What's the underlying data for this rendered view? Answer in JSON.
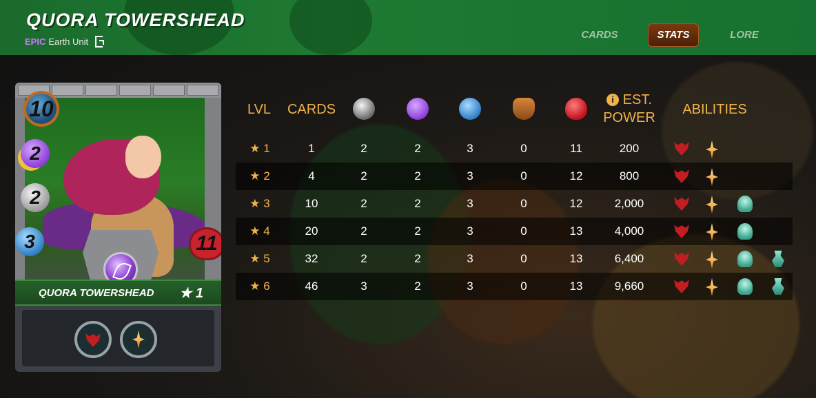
{
  "header": {
    "title": "QUORA TOWERSHEAD",
    "rarity": "EPIC",
    "unit_type": "Earth Unit",
    "edition_icon": "g-edition-icon"
  },
  "tabs": [
    {
      "label": "CARDS",
      "active": false
    },
    {
      "label": "STATS",
      "active": true
    },
    {
      "label": "LORE",
      "active": false
    }
  ],
  "card": {
    "name": "QUORA TOWERSHEAD",
    "level_label": "★ 1",
    "mana": "10",
    "magic": "2",
    "attack": "2",
    "speed": "3",
    "health": "11",
    "abilities": [
      "demon-ability-icon",
      "spark-ability-icon"
    ]
  },
  "table": {
    "headers": {
      "lvl": "LVL",
      "cards": "CARDS",
      "attack_icon": "attack-icon",
      "magic_icon": "magic-icon",
      "speed_icon": "speed-icon",
      "armor_icon": "armor-icon",
      "health_icon": "health-icon",
      "power_line1": "EST.",
      "power_line2": "POWER",
      "abilities": "ABILITIES"
    },
    "rows": [
      {
        "lvl": "★ 1",
        "cards": "1",
        "attack": "2",
        "magic": "2",
        "speed": "3",
        "armor": "0",
        "health": "11",
        "power": "200",
        "abilities": [
          "demon",
          "spark"
        ]
      },
      {
        "lvl": "★ 2",
        "cards": "4",
        "attack": "2",
        "magic": "2",
        "speed": "3",
        "armor": "0",
        "health": "12",
        "power": "800",
        "abilities": [
          "demon",
          "spark"
        ]
      },
      {
        "lvl": "★ 3",
        "cards": "10",
        "attack": "2",
        "magic": "2",
        "speed": "3",
        "armor": "0",
        "health": "12",
        "power": "2,000",
        "abilities": [
          "demon",
          "spark",
          "ghost"
        ]
      },
      {
        "lvl": "★ 4",
        "cards": "20",
        "attack": "2",
        "magic": "2",
        "speed": "3",
        "armor": "0",
        "health": "13",
        "power": "4,000",
        "abilities": [
          "demon",
          "spark",
          "ghost"
        ]
      },
      {
        "lvl": "★ 5",
        "cards": "32",
        "attack": "2",
        "magic": "2",
        "speed": "3",
        "armor": "0",
        "health": "13",
        "power": "6,400",
        "abilities": [
          "demon",
          "spark",
          "ghost",
          "potion"
        ]
      },
      {
        "lvl": "★ 6",
        "cards": "46",
        "attack": "3",
        "magic": "2",
        "speed": "3",
        "armor": "0",
        "health": "13",
        "power": "9,660",
        "abilities": [
          "demon",
          "spark",
          "ghost",
          "potion"
        ]
      }
    ]
  },
  "colors": {
    "header_green": "#1e7a32",
    "accent_gold": "#f1b24a",
    "rarity_purple": "#c678ff",
    "active_tab": "#6a3010"
  }
}
